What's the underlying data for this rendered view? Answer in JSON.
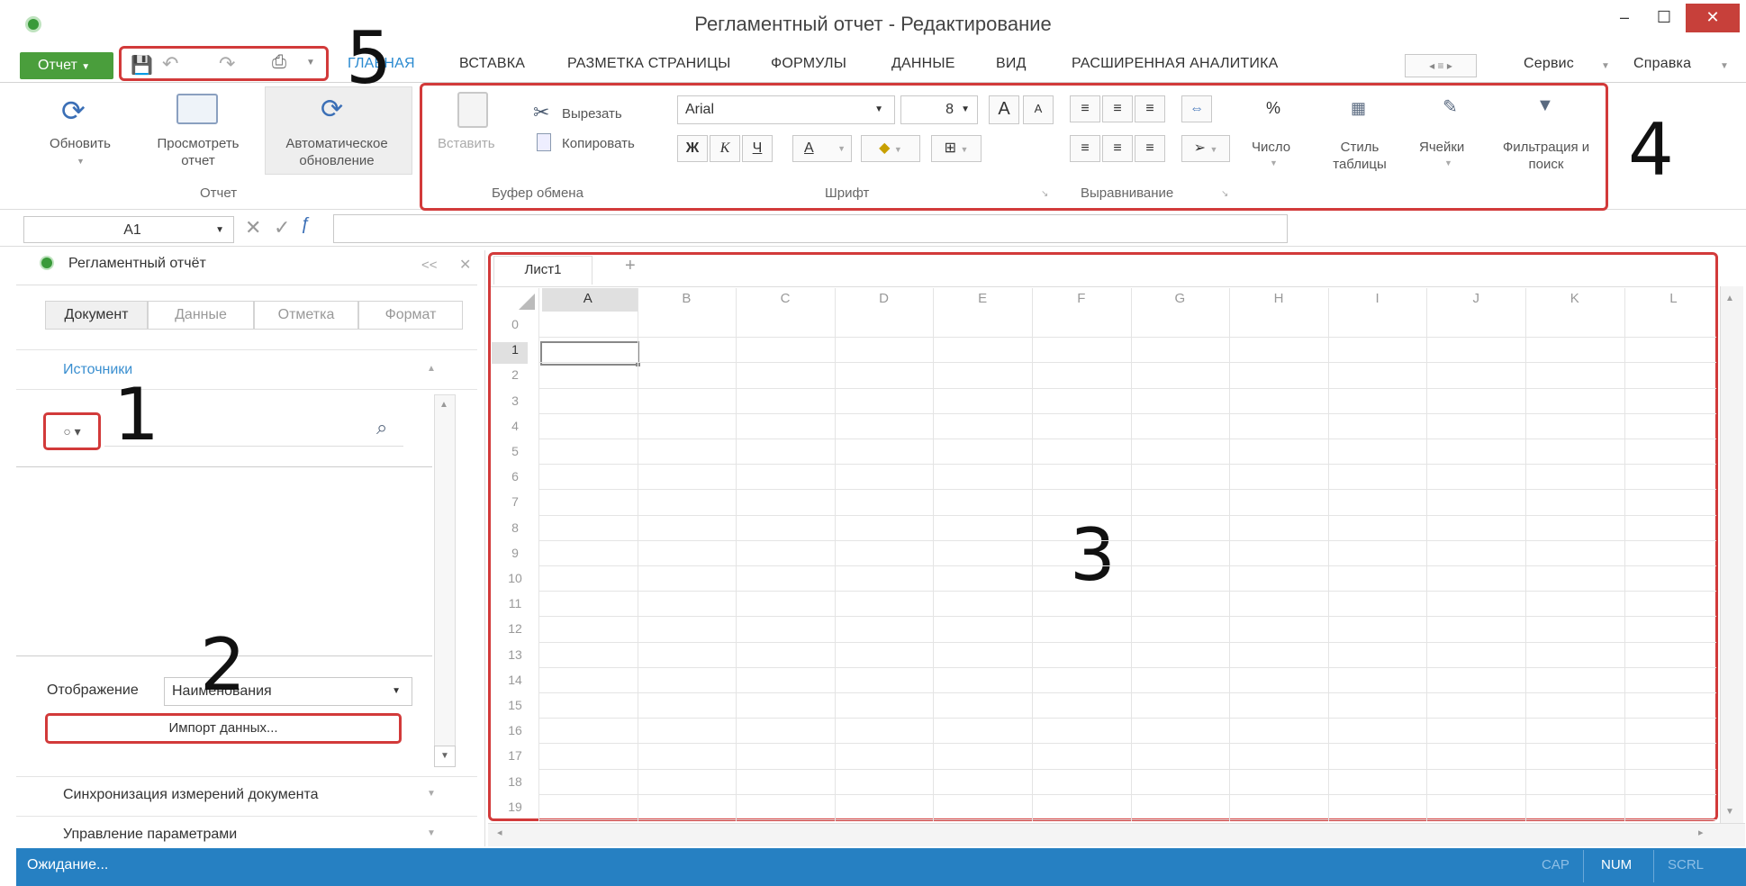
{
  "window": {
    "title": "Регламентный отчет - Редактирование",
    "minimize": "–",
    "maximize": "☐",
    "close": "✕"
  },
  "menu": {
    "report_button": "Отчет",
    "tabs": [
      "ГЛАВНАЯ",
      "ВСТАВКА",
      "РАЗМЕТКА СТРАНИЦЫ",
      "ФОРМУЛЫ",
      "ДАННЫЕ",
      "ВИД",
      "РАСШИРЕННАЯ АНАЛИТИКА"
    ],
    "service": "Сервис",
    "help": "Справка"
  },
  "ribbon": {
    "refresh": "Обновить",
    "preview": "Просмотреть отчет",
    "auto_update": "Автоматическое обновление",
    "group_report": "Отчет",
    "paste": "Вставить",
    "cut": "Вырезать",
    "copy": "Копировать",
    "group_clipboard": "Буфер обмена",
    "font_name": "Arial",
    "font_size": "8",
    "bold": "Ж",
    "italic": "К",
    "underline": "Ч",
    "font_color": "А",
    "group_font": "Шрифт",
    "group_align": "Выравнивание",
    "number": "Число",
    "percent": "%",
    "table_style": "Стиль таблицы",
    "cells": "Ячейки",
    "filter": "Фильтрация и поиск"
  },
  "formula": {
    "cell_ref": "A1",
    "value": ""
  },
  "left_panel": {
    "title": "Регламентный отчёт",
    "collapse": "<<",
    "close": "✕",
    "tabs": [
      "Документ",
      "Данные",
      "Отметка",
      "Формат"
    ],
    "sources_label": "Источники",
    "display_label": "Отображение",
    "display_value": "Наименования",
    "import_button": "Импорт данных...",
    "sync_label": "Синхронизация измерений документа",
    "params_label": "Управление параметрами"
  },
  "sheet": {
    "tab": "Лист1",
    "add": "+",
    "columns": [
      "A",
      "B",
      "C",
      "D",
      "E",
      "F",
      "G",
      "H",
      "I",
      "J",
      "K",
      "L"
    ],
    "rows": [
      "0",
      "1",
      "2",
      "3",
      "4",
      "5",
      "6",
      "7",
      "8",
      "9",
      "10",
      "11",
      "12",
      "13",
      "14",
      "15",
      "16",
      "17",
      "18",
      "19"
    ],
    "selected_cell": "A1"
  },
  "status": {
    "text": "Ожидание...",
    "cap": "CAP",
    "num": "NUM",
    "scrl": "SCRL"
  },
  "annotations": [
    "1",
    "2",
    "3",
    "4",
    "5"
  ],
  "colors": {
    "accent_green": "#4a9e3c",
    "status_blue": "#2680c2",
    "highlight_red": "#d23a3a",
    "close_red": "#c7403a"
  }
}
